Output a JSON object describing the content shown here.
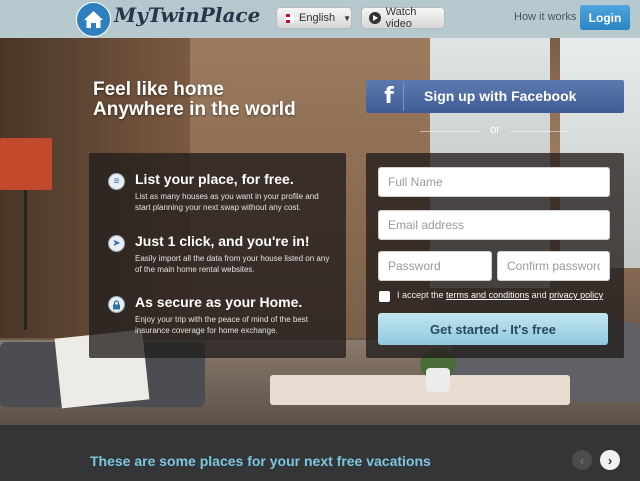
{
  "header": {
    "logo_text": "MyTwinPlace",
    "language": "English",
    "watch_video": "Watch video",
    "how_it_works": "How it works",
    "login": "Login"
  },
  "hero": {
    "headline_line1": "Feel like home",
    "headline_line2": "Anywhere in the world"
  },
  "features": [
    {
      "title": "List your place, for free.",
      "desc": "List as many houses as you want in your profile and start planning your next swap without any cost.",
      "icon": "list-icon"
    },
    {
      "title": "Just 1 click, and you're in!",
      "desc": "Easily import all the data from your house listed on any of the main home rental websites.",
      "icon": "cursor-icon"
    },
    {
      "title": "As secure as your Home.",
      "desc": "Enjoy your trip with the peace of mind of the best insurance coverage for home exchange.",
      "icon": "lock-icon"
    }
  ],
  "signup": {
    "facebook_label": "Sign up with Facebook",
    "or": "or",
    "full_name_placeholder": "Full Name",
    "email_placeholder": "Email address",
    "password_placeholder": "Password",
    "confirm_password_placeholder": "Confirm password",
    "terms_prefix": "I accept the",
    "terms_link": "terms and conditions",
    "terms_and": "and",
    "privacy_link": "privacy policy",
    "submit_label": "Get started - It's free"
  },
  "bottom": {
    "places_text": "These are some places for your next free vacations",
    "prev": "‹",
    "next": "›"
  },
  "colors": {
    "accent": "#2c83c3",
    "facebook": "#3f5c95",
    "bottom_text": "#7dc7df"
  }
}
